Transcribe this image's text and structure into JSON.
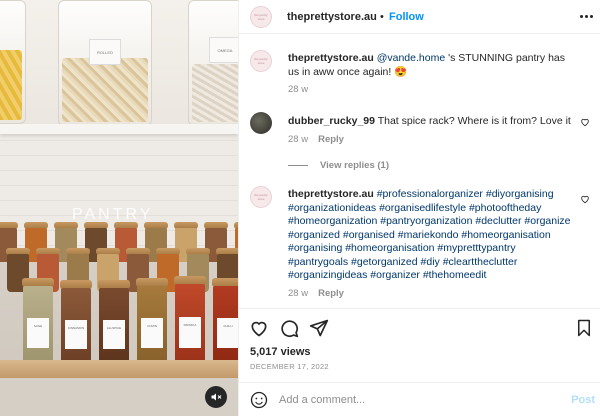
{
  "media": {
    "overlay_text": "PANTRY",
    "container_labels": [
      "ROLLED",
      "OMEGA"
    ],
    "jar_labels": [
      "SAGE",
      "CINNAMON",
      "ALLSPICE",
      "CUMIN",
      "PAPRIKA",
      "CHILLI"
    ]
  },
  "header": {
    "avatar_text": "the pretty store",
    "username": "theprettystore.au",
    "separator": "•",
    "follow_label": "Follow",
    "more_icon": "more-horizontal-icon"
  },
  "caption": {
    "username": "theprettystore.au",
    "mention": "@vande.home",
    "text": " 's STUNNING pantry has us in aww once again! 😍",
    "time": "28 w"
  },
  "comment": {
    "username": "dubber_rucky_99",
    "text": " That spice rack? Where is it from? Love it",
    "time": "28 w",
    "reply_label": "Reply",
    "view_replies": "View replies (1)"
  },
  "hashtag_comment": {
    "username": "theprettystore.au",
    "hashtags": "#professionalorganizer #diyorganising #organizationideas #organisedlifestyle #photooftheday #homeorganization #pantryorganization #declutter #organize #organized #organised #mariekondo #homeorganisation #organising #homeorganisation #mypretttypantry #pantrygoals #getorganized #diy #clearttheclutter #organizingideas #organizer #thehomeedit",
    "time": "28 w",
    "reply_label": "Reply"
  },
  "stats": {
    "views": "5,017 views",
    "date": "DECEMBER 17, 2022"
  },
  "add_comment": {
    "placeholder": "Add a comment...",
    "post_label": "Post"
  }
}
